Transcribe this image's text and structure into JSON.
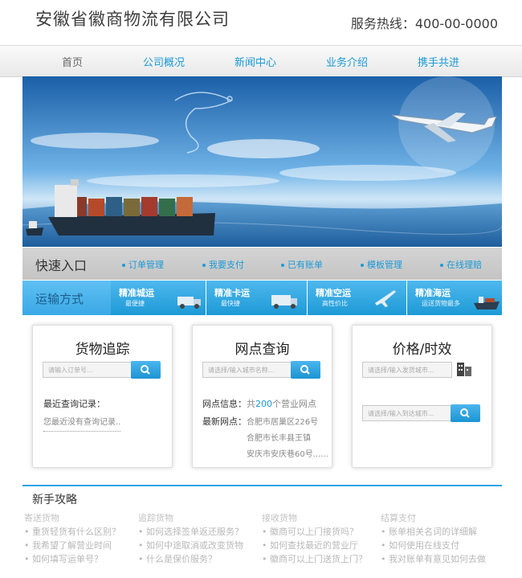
{
  "header": {
    "company": "安徽省徽商物流有限公司",
    "hotline": "服务热线：400-00-0000"
  },
  "nav": [
    "首页",
    "公司概况",
    "新闻中心",
    "业务介绍",
    "携手共进"
  ],
  "quick": {
    "title": "快速入口",
    "links": [
      "订单管理",
      "我要支付",
      "已有账单",
      "模板管理",
      "在线理赔"
    ]
  },
  "transport": {
    "title": "运输方式",
    "items": [
      {
        "name": "精准城运",
        "sub": "最便捷"
      },
      {
        "name": "精准卡运",
        "sub": "最快捷"
      },
      {
        "name": "精准空运",
        "sub": "高性价比"
      },
      {
        "name": "精准海运",
        "sub": "运送货物最多"
      }
    ]
  },
  "tracking": {
    "title": "货物追踪",
    "placeholder": "请输入订单号...",
    "recent_label": "最近查询记录：",
    "recent_empty": "您最近没有查询记录.."
  },
  "outlets": {
    "title": "网点查询",
    "placeholder": "请选择/输入城市名称...",
    "info_label": "网点信息：",
    "info_pre": "共",
    "info_count": "200",
    "info_post": "个营业网点",
    "latest_label": "最新网点：",
    "latest": [
      "合肥市居巢区226号",
      "合肥市长丰县王镇",
      "安庆市安庆巷60号......"
    ]
  },
  "pricing": {
    "title": "价格/时效",
    "placeholder_from": "请选择/输入发货城市...",
    "placeholder_to": "请选择/输入到达城市..."
  },
  "faq": {
    "title": "新手攻略",
    "columns": [
      {
        "head": "寄送货物",
        "items": [
          "重货轻货有什么区别？",
          "我希望了解营业时间",
          "如何填写运单号？"
        ]
      },
      {
        "head": "追踪货物",
        "items": [
          "如何选择签单返还服务？",
          "如何中途取消或改变货物",
          "什么是保价服务？"
        ]
      },
      {
        "head": "接收货物",
        "items": [
          "徽商可以上门接货吗？",
          "如何查找最近的营业厅",
          "徽商可以上门送货上门？"
        ]
      },
      {
        "head": "结算支付",
        "items": [
          "账单相关名词的详细解",
          "如何使用在线支付",
          "我对账单有意见如何去做"
        ]
      }
    ]
  },
  "colors": {
    "accent": "#1a9ad6",
    "accent_dark": "#1d9ad6"
  }
}
